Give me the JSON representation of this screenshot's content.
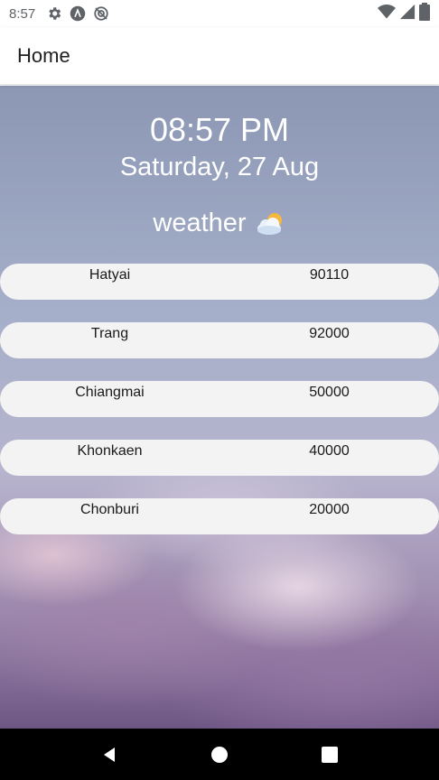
{
  "status_bar": {
    "time": "8:57",
    "icons": [
      "settings-icon",
      "a-icon",
      "sync-icon"
    ],
    "right_icons": [
      "wifi-icon",
      "signal-icon",
      "battery-icon"
    ]
  },
  "app_bar": {
    "title": "Home"
  },
  "main": {
    "clock": "08:57 PM",
    "date": "Saturday, 27 Aug",
    "weather_label": "weather",
    "weather_icon": "cloud-sun-icon",
    "cities": [
      {
        "name": "Hatyai",
        "zip": "90110"
      },
      {
        "name": "Trang",
        "zip": "92000"
      },
      {
        "name": "Chiangmai",
        "zip": "50000"
      },
      {
        "name": "Khonkaen",
        "zip": "40000"
      },
      {
        "name": "Chonburi",
        "zip": "20000"
      }
    ]
  },
  "nav_bar": {
    "icons": [
      "back-icon",
      "home-icon",
      "recents-icon"
    ]
  },
  "colors": {
    "row_background": "#f3f3f3",
    "text_on_background": "#ffffff",
    "nav_background": "#000000"
  }
}
